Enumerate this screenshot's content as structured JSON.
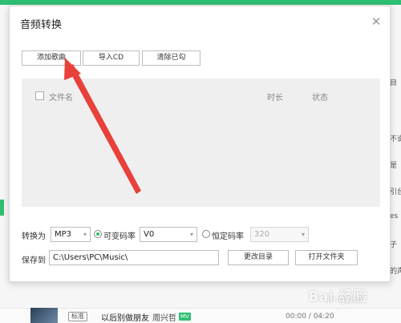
{
  "dialog": {
    "title": "音频转换",
    "close_glyph": "✕"
  },
  "toolbar": {
    "add_label": "添加歌曲",
    "import_cd_label": "导入CD",
    "clear_label": "清除已勾"
  },
  "list": {
    "columns": {
      "name": "文件名",
      "duration": "时长",
      "status": "状态"
    }
  },
  "settings": {
    "convert_label": "转换为",
    "format_value": "MP3",
    "vbr_label": "可变码率",
    "vbr_selected": true,
    "vbr_value": "V0",
    "cbr_label": "恒定码率",
    "cbr_value": "320",
    "save_label": "保存到",
    "save_path": "C:\\Users\\PC\\Music\\",
    "change_dir_label": "更改目录",
    "open_folder_label": "打开文件夹",
    "dropdown_glyph": "▾"
  },
  "background": {
    "right_fragments": [
      "目",
      "不说",
      "是",
      "引台",
      "es I",
      "子",
      "的声"
    ],
    "song_tag": "标准",
    "song_title": "以后别做朋友",
    "song_artist": "周兴哲",
    "song_mv": "MV",
    "song_time": "00:00 / 04:20"
  },
  "watermark": {
    "text": "Bai 经验",
    "sub": "jingyan"
  },
  "colors": {
    "accent": "#2fbf71",
    "arrow": "#e8403a"
  }
}
